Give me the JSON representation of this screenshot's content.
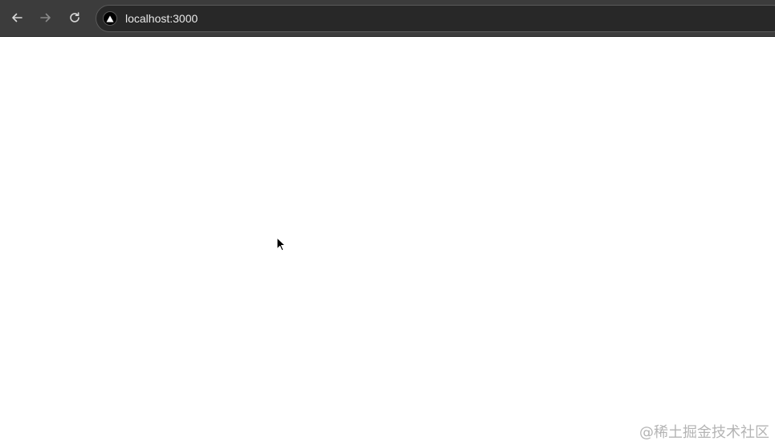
{
  "browser": {
    "url": "localhost:3000",
    "site_icon": "vercel-triangle-icon",
    "nav": {
      "back_icon": "arrow-left-icon",
      "forward_icon": "arrow-right-icon",
      "reload_icon": "reload-icon"
    },
    "colors": {
      "toolbar": "#3c3c3c",
      "omnibox": "#282828",
      "url_text": "#e8e8e8"
    }
  },
  "page": {
    "background": "#ffffff",
    "cursor_icon": "mouse-pointer-icon"
  },
  "watermark": {
    "text": "@稀土掘金技术社区"
  }
}
